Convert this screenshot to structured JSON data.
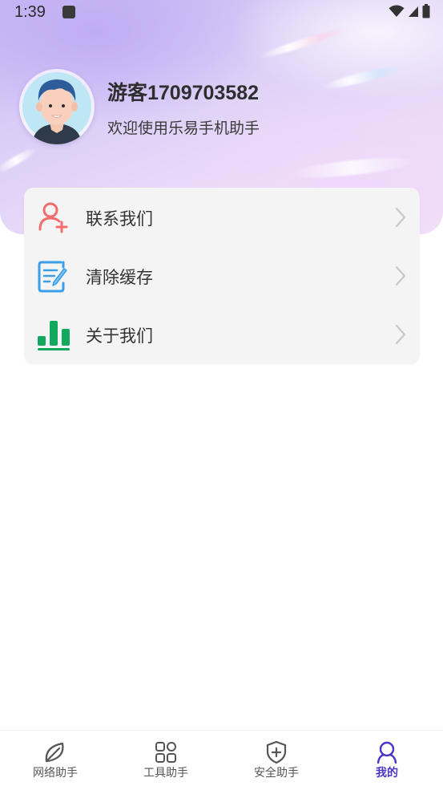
{
  "status_bar": {
    "time": "1:39",
    "icons": [
      "notification-square-icon",
      "wifi-icon",
      "signal-icon",
      "battery-icon"
    ]
  },
  "profile": {
    "username": "游客1709703582",
    "welcome": "欢迎使用乐易手机助手",
    "avatar_icon": "cartoon-boy-avatar"
  },
  "menu": {
    "items": [
      {
        "label": "联系我们",
        "icon": "add-contact-icon",
        "color": "#f26d6d"
      },
      {
        "label": "清除缓存",
        "icon": "document-edit-icon",
        "color": "#3a9ee8"
      },
      {
        "label": "关于我们",
        "icon": "bar-chart-icon",
        "color": "#12a85e"
      }
    ]
  },
  "bottom_nav": {
    "items": [
      {
        "label": "网络助手",
        "icon": "leaf-icon",
        "active": false
      },
      {
        "label": "工具助手",
        "icon": "grid-icon",
        "active": false
      },
      {
        "label": "安全助手",
        "icon": "shield-plus-icon",
        "active": false
      },
      {
        "label": "我的",
        "icon": "person-icon",
        "active": true
      }
    ]
  },
  "colors": {
    "accent": "#4b35c7",
    "hero_gradient_start": "#c8b9f2",
    "hero_gradient_end": "#f1e3f7",
    "card_background": "#f4f4f4"
  }
}
